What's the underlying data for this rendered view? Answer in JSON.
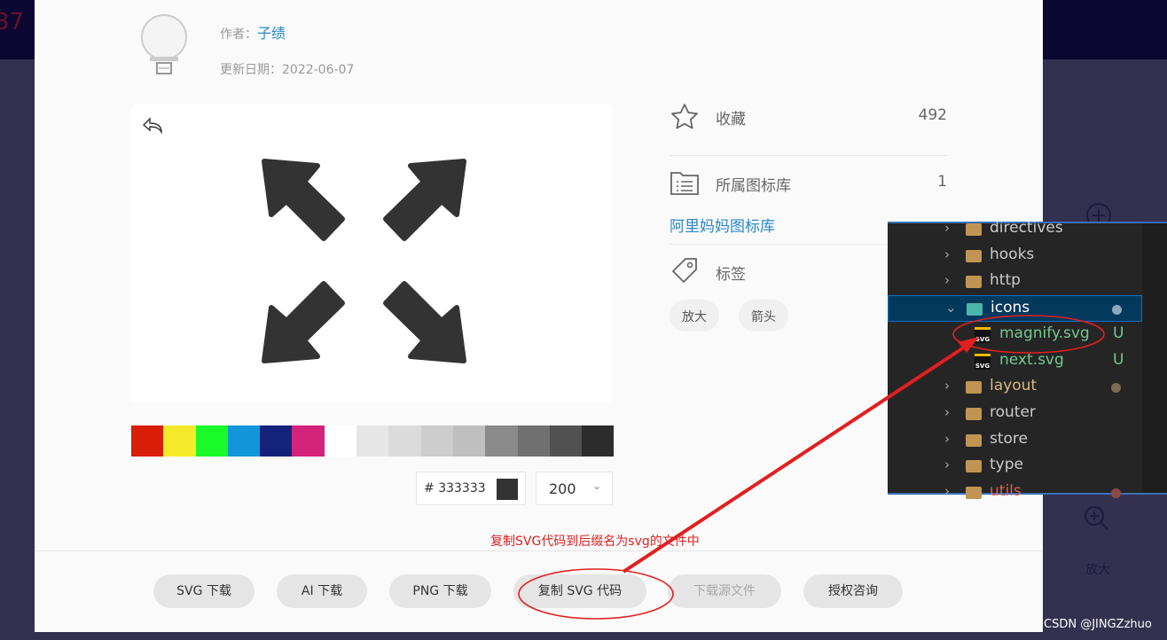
{
  "author": {
    "label": "作者：",
    "name": "子绩"
  },
  "updated": {
    "label": "更新日期：",
    "date": "2022-06-07"
  },
  "swatches": [
    "#d81e06",
    "#f4ea2a",
    "#1afa29",
    "#1296db",
    "#13227a",
    "#d4237a",
    "#ffffff",
    "#e6e6e6",
    "#dbdbdb",
    "#cdcdcd",
    "#bfbfbf",
    "#8a8a8a",
    "#707070",
    "#515151",
    "#2c2c2c"
  ],
  "color": {
    "prefix": "#",
    "value": "333333",
    "current": "#333333"
  },
  "size": {
    "value": "200"
  },
  "info": {
    "favorite_label": "收藏",
    "favorite_count": "492",
    "library_label": "所属图标库",
    "library_count": "1",
    "library_name": "阿里妈妈图标库",
    "tags_label": "标签",
    "tags": [
      "放大",
      "箭头"
    ]
  },
  "annotation": "复制SVG代码到后缀名为svg的文件中",
  "buttons": [
    {
      "label": "SVG 下载"
    },
    {
      "label": "AI 下载"
    },
    {
      "label": "PNG 下载"
    },
    {
      "label": "复制 SVG 代码"
    },
    {
      "label": "下载源文件"
    },
    {
      "label": "授权咨询"
    }
  ],
  "explorer": [
    {
      "name": "directives",
      "type": "folder",
      "color": "#cccccc"
    },
    {
      "name": "hooks",
      "type": "folder",
      "color": "#cccccc"
    },
    {
      "name": "http",
      "type": "folder",
      "color": "#cccccc"
    },
    {
      "name": "icons",
      "type": "folder-open",
      "color": "#ffffff",
      "dot": "#8fa6bf",
      "selected": true
    },
    {
      "name": "magnify.svg",
      "type": "svg",
      "color": "#73c991",
      "status": "U"
    },
    {
      "name": "next.svg",
      "type": "svg",
      "color": "#73c991",
      "status": "U"
    },
    {
      "name": "layout",
      "type": "folder",
      "color": "#d7ba7d",
      "dot": "#7d6c55"
    },
    {
      "name": "router",
      "type": "folder",
      "color": "#cccccc"
    },
    {
      "name": "store",
      "type": "folder",
      "color": "#cccccc"
    },
    {
      "name": "type",
      "type": "folder",
      "color": "#cccccc"
    },
    {
      "name": "utils",
      "type": "folder",
      "color": "#e0614e",
      "dot": "#8b4a46"
    }
  ],
  "side": {
    "zoom_label": "放大"
  },
  "watermark": "CSDN @JINGZzhuo"
}
